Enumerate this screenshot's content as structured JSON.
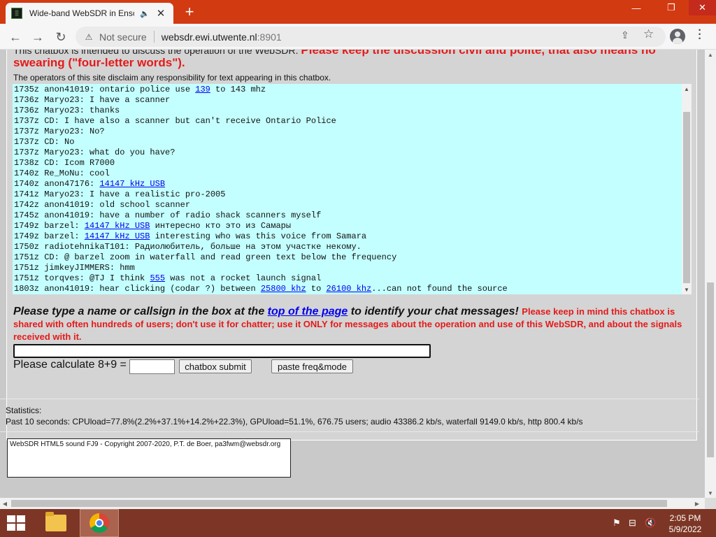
{
  "browser": {
    "tab_title": "Wide-band WebSDR in Enschede",
    "tab_icon": "websdr-favicon",
    "not_secure": "Not secure",
    "url_host": "websdr.ewi.utwente.nl",
    "url_port": ":8901"
  },
  "chat": {
    "intro": "This chatbox is intended to discuss the operation of the WebSDR. ",
    "intro_red": "Please keep the discussion civil and polite, that also means no",
    "swearing": "swearing (\"four-letter words\").",
    "disclaimer": "The operators of this site disclaim any responsibility for text appearing in this chatbox.",
    "lines": [
      [
        {
          "t": "1735z anon41019: ontario police use "
        },
        {
          "t": "139",
          "link": true
        },
        {
          "t": " to 143 mhz"
        }
      ],
      [
        {
          "t": "1736z Maryo23: I have a scanner"
        }
      ],
      [
        {
          "t": "1736z Maryo23: thanks"
        }
      ],
      [
        {
          "t": "1737z CD: I have also a scanner but can't receive Ontario Police"
        }
      ],
      [
        {
          "t": "1737z Maryo23: No?"
        }
      ],
      [
        {
          "t": "1737z CD: No"
        }
      ],
      [
        {
          "t": "1737z Maryo23: what do you have?"
        }
      ],
      [
        {
          "t": "1738z CD: Icom R7000"
        }
      ],
      [
        {
          "t": "1740z Re_MoNu: cool"
        }
      ],
      [
        {
          "t": "1740z anon47176: "
        },
        {
          "t": "14147 kHz USB",
          "link": true
        }
      ],
      [
        {
          "t": "1741z Maryo23: I have a realistic pro-2005"
        }
      ],
      [
        {
          "t": "1742z anon41019: old school scanner"
        }
      ],
      [
        {
          "t": "1745z anon41019: have a number of radio shack scanners myself"
        }
      ],
      [
        {
          "t": "1749z barzel: "
        },
        {
          "t": "14147 kHz USB",
          "link": true
        },
        {
          "t": " интересно кто это из Самары"
        }
      ],
      [
        {
          "t": "1749z barzel: "
        },
        {
          "t": "14147 kHz USB",
          "link": true
        },
        {
          "t": " interesting who was this voice from Samara"
        }
      ],
      [
        {
          "t": "1750z radiotehnikaT101: Радиолюбитель, больше на этом участке некому."
        }
      ],
      [
        {
          "t": "1751z CD: @ barzel zoom in waterfall and read green text below the frequency"
        }
      ],
      [
        {
          "t": "1751z jimkeyJIMMERS: hmm"
        }
      ],
      [
        {
          "t": "1751z torqves: @TJ I think "
        },
        {
          "t": "555",
          "link": true
        },
        {
          "t": " was not a rocket launch signal"
        }
      ],
      [
        {
          "t": "1803z anon41019: hear clicking (codar ?) between "
        },
        {
          "t": "25800 khz",
          "link": true
        },
        {
          "t": " to "
        },
        {
          "t": "26100 khz",
          "link": true
        },
        {
          "t": "...can not found the source"
        }
      ]
    ],
    "prompt_start": "Please type a name or callsign in the box at the ",
    "prompt_link": "top of the page",
    "prompt_end": " to identify your chat messages! ",
    "prompt_red": "Please keep in mind this chatbox is shared with often hundreds of users; don't use it for chatter; use it ONLY for messages about the operation and use of this WebSDR, and about the signals received with it.",
    "calc_label": "Please calculate 8+9 =",
    "submit_label": "chatbox submit",
    "paste_label": "paste freq&mode",
    "input_value": "",
    "calc_value": ""
  },
  "stats": {
    "heading": "Statistics:",
    "line": "Past 10 seconds: CPUload=77.8%(2.2%+37.1%+14.2%+22.3%), GPUload=51.1%, 676.75 users; audio 43386.2 kb/s, waterfall 9149.0 kb/s, http 800.4 kb/s"
  },
  "credits": "WebSDR HTML5 sound FJ9 - Copyright 2007-2020, P.T. de Boer, pa3fwm@websdr.org",
  "taskbar": {
    "time": "2:05 PM",
    "date": "5/9/2022"
  },
  "colors": {
    "titlebar": "#d23a12",
    "chat_bg": "#c4ffff",
    "warning_red": "#e41a1a",
    "link": "#0000ee",
    "taskbar": "#7d3625"
  }
}
